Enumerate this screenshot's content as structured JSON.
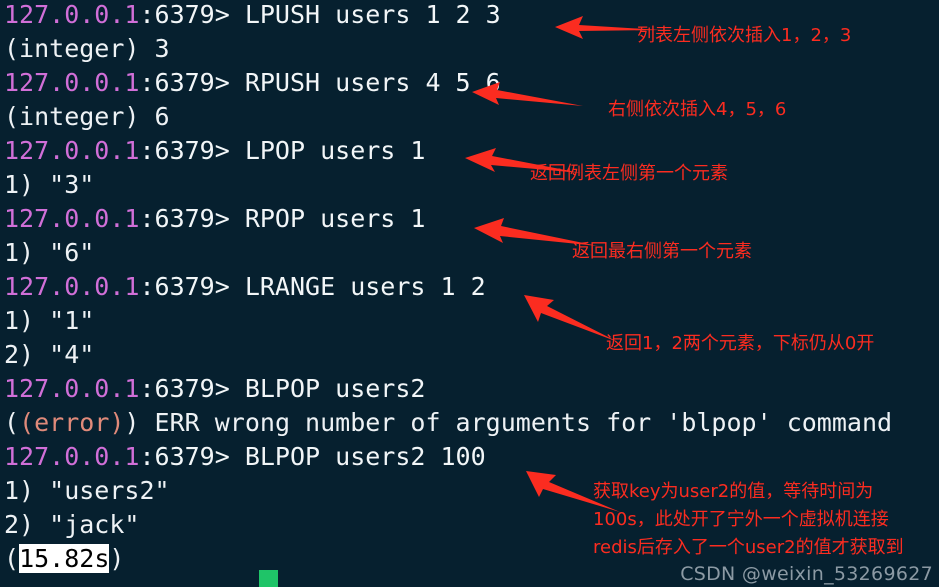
{
  "terminal": {
    "prompt_host": "127.0.0.1",
    "prompt_port": ":6379>",
    "lines": [
      {
        "type": "prompt",
        "command": " LPUSH users 1 2 3"
      },
      {
        "type": "output",
        "text": "(integer) 3"
      },
      {
        "type": "prompt",
        "command": " RPUSH users 4 5 6"
      },
      {
        "type": "output",
        "text": "(integer) 6"
      },
      {
        "type": "prompt",
        "command": " LPOP users 1"
      },
      {
        "type": "output",
        "text": "1) \"3\""
      },
      {
        "type": "prompt",
        "command": " RPOP users 1"
      },
      {
        "type": "output",
        "text": "1) \"6\""
      },
      {
        "type": "prompt",
        "command": " LRANGE users 1 2"
      },
      {
        "type": "output",
        "text": "1) \"1\""
      },
      {
        "type": "output",
        "text": "2) \"4\""
      },
      {
        "type": "prompt",
        "command": " BLPOP users2"
      },
      {
        "type": "error",
        "tag": "(error)",
        "text": " ERR wrong number of arguments for 'blpop' command"
      },
      {
        "type": "prompt",
        "command": " BLPOP users2 100"
      },
      {
        "type": "output",
        "text": "1) \"users2\""
      },
      {
        "type": "output",
        "text": "2) \"jack\""
      },
      {
        "type": "timing",
        "open": "(",
        "selected": "15.82s",
        "close": ")"
      }
    ]
  },
  "annotations": [
    {
      "id": "anno-lpush",
      "text": "列表左侧依次插入1，2，3"
    },
    {
      "id": "anno-rpush",
      "text": "右侧依次插入4，5，6"
    },
    {
      "id": "anno-lpop",
      "text": "返回例表左侧第一个元素"
    },
    {
      "id": "anno-rpop",
      "text": "返回最右侧第一个元素"
    },
    {
      "id": "anno-lrange",
      "text": "返回1，2两个元素，下标仍从0开"
    },
    {
      "id": "anno-blpop-1",
      "text": "获取key为user2的值，等待时间为"
    },
    {
      "id": "anno-blpop-2",
      "text": "100s，此处开了宁外一个虚拟机连接"
    },
    {
      "id": "anno-blpop-3",
      "text": "redis后存入了一个user2的值才获取到"
    }
  ],
  "watermark": {
    "text": "CSDN @weixin_53269627"
  },
  "colors": {
    "background": "#06202f",
    "prompt_host": "#d16fd8",
    "terminal_text": "#eef2f5",
    "error": "#e08a7a",
    "annotation": "#fb2c20",
    "cursor": "#1fc468",
    "watermark": "#8c9aa4"
  }
}
